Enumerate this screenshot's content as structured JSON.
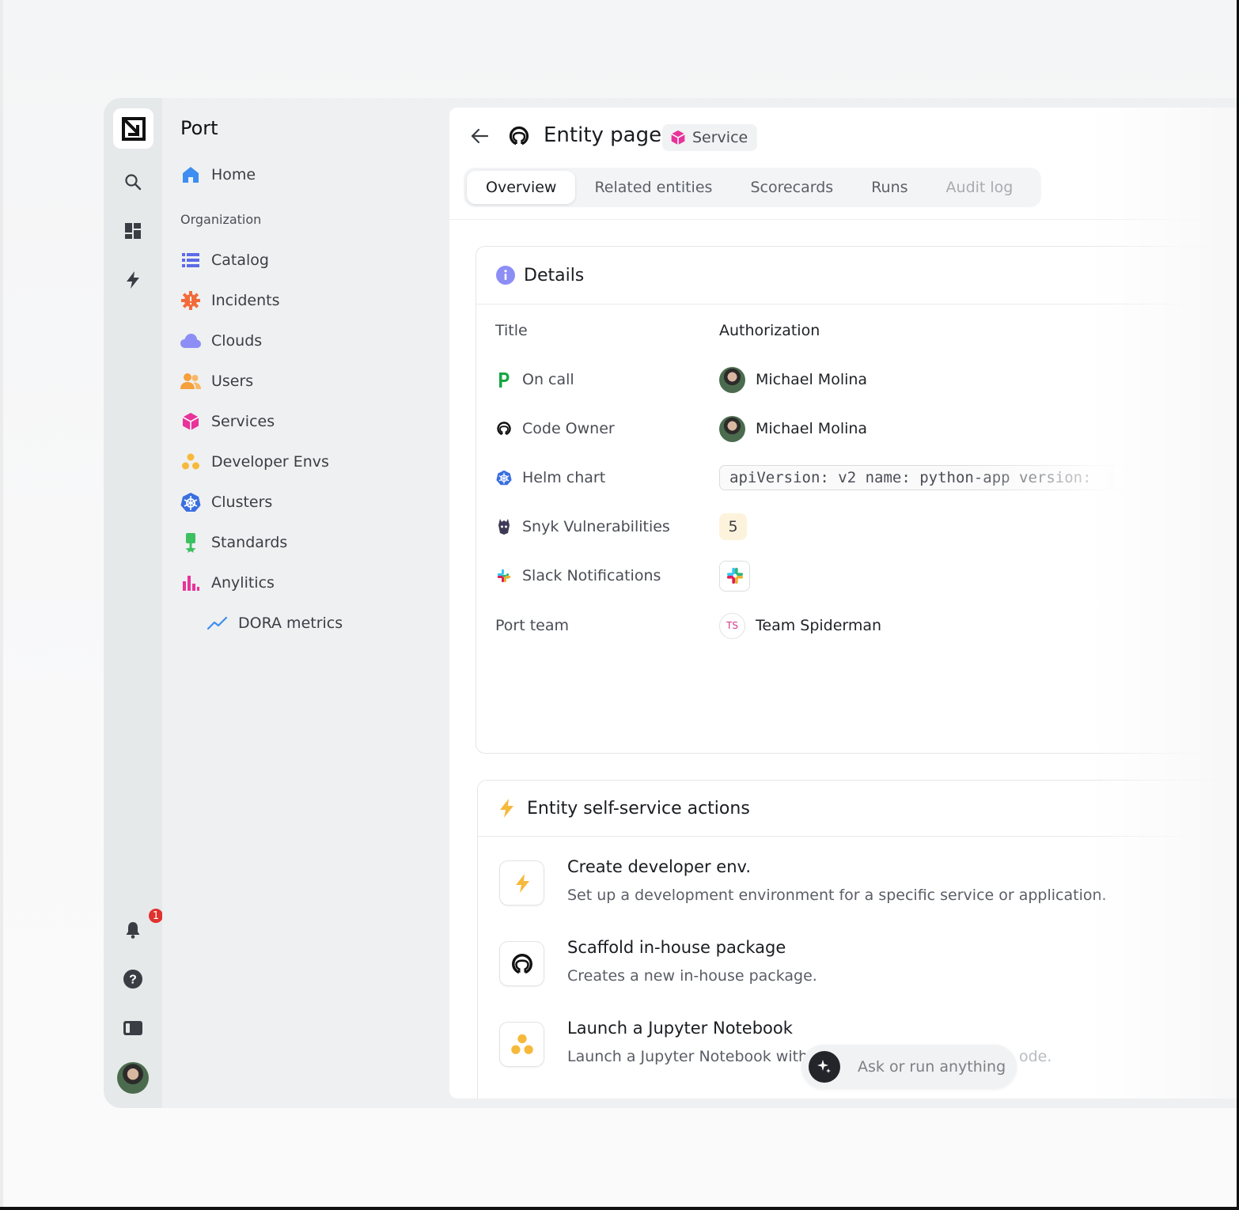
{
  "app": {
    "name": "Port"
  },
  "rail": {
    "notification_count": "1"
  },
  "sidebar": {
    "home": "Home",
    "section": "Organization",
    "items": [
      {
        "label": "Catalog",
        "icon": "list-icon",
        "color": "#5b6be8"
      },
      {
        "label": "Incidents",
        "icon": "incident-gear-icon",
        "color": "#f26b3a"
      },
      {
        "label": "Clouds",
        "icon": "cloud-icon",
        "color": "#8d8ef5"
      },
      {
        "label": "Users",
        "icon": "users-icon",
        "color": "#f5a03a"
      },
      {
        "label": "Services",
        "icon": "cube-icon",
        "color": "#e8339a"
      },
      {
        "label": "Developer Envs",
        "icon": "dots-icon",
        "color": "#f6b93b"
      },
      {
        "label": "Clusters",
        "icon": "kubernetes-icon",
        "color": "#3a6fe0"
      },
      {
        "label": "Standards",
        "icon": "medal-icon",
        "color": "#3cc060"
      },
      {
        "label": "Anylitics",
        "icon": "bar-chart-icon",
        "color": "#e8339a"
      }
    ],
    "sub_item": "DORA metrics"
  },
  "header": {
    "title": "Entity page",
    "kind": "Service",
    "tabs": [
      "Overview",
      "Related entities",
      "Scorecards",
      "Runs",
      "Audit log"
    ]
  },
  "details": {
    "title": "Details",
    "rows": {
      "title": {
        "label": "Title",
        "value": "Authorization"
      },
      "oncall": {
        "label": "On call",
        "value": "Michael Molina"
      },
      "codeowner": {
        "label": "Code Owner",
        "value": "Michael Molina"
      },
      "helm": {
        "label": "Helm chart",
        "value": "apiVersion: v2 name: python-app version:"
      },
      "snyk": {
        "label": "Snyk Vulnerabilities",
        "value": "5"
      },
      "slack": {
        "label": "Slack Notifications"
      },
      "team": {
        "label": "Port team",
        "initials": "TS",
        "value": "Team Spiderman"
      }
    }
  },
  "actions": {
    "title": "Entity self-service actions",
    "items": [
      {
        "title": "Create developer env.",
        "description": "Set up a development environment for a specific service or application."
      },
      {
        "title": "Scaffold in-house package",
        "description": "Creates a new in-house package."
      },
      {
        "title": "Launch a Jupyter Notebook",
        "description": "Launch a Jupyter Notebook withi"
      }
    ],
    "trailing_fragment": "ode."
  },
  "ask": {
    "placeholder": "Ask or run anything"
  }
}
